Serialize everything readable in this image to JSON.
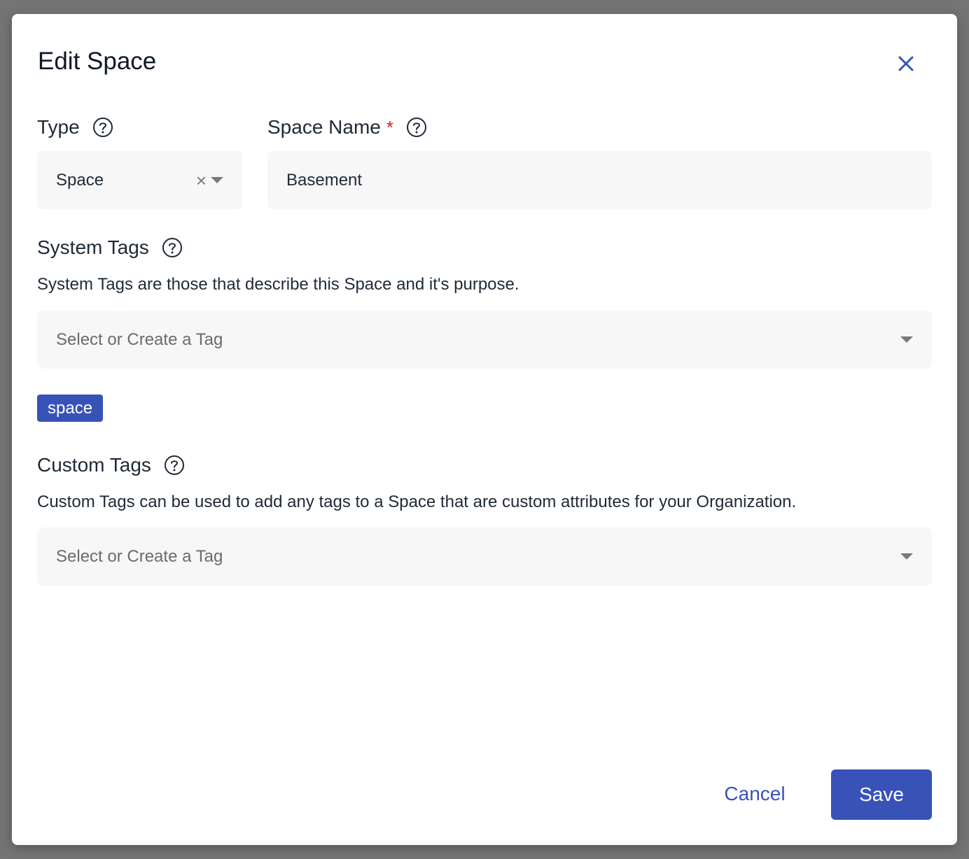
{
  "dialog": {
    "title": "Edit Space"
  },
  "type_field": {
    "label": "Type",
    "value": "Space",
    "clear_glyph": "×"
  },
  "space_name_field": {
    "label": "Space Name",
    "required_mark": "*",
    "value": "Basement"
  },
  "system_tags": {
    "label": "System Tags",
    "description": "System Tags are those that describe this Space and it's purpose.",
    "placeholder": "Select or Create a Tag",
    "chips": [
      "space"
    ]
  },
  "custom_tags": {
    "label": "Custom Tags",
    "description": "Custom Tags can be used to add any tags to a Space that are custom attributes for your Organization.",
    "placeholder": "Select or Create a Tag"
  },
  "footer": {
    "cancel_label": "Cancel",
    "save_label": "Save"
  },
  "colors": {
    "accent": "#3952b8",
    "required": "#c62828",
    "overlay": "#747474",
    "field_bg": "#f7f7f7"
  },
  "icons": {
    "close": "close-icon",
    "help": "help-circle-icon",
    "dropdown": "chevron-down-icon"
  }
}
